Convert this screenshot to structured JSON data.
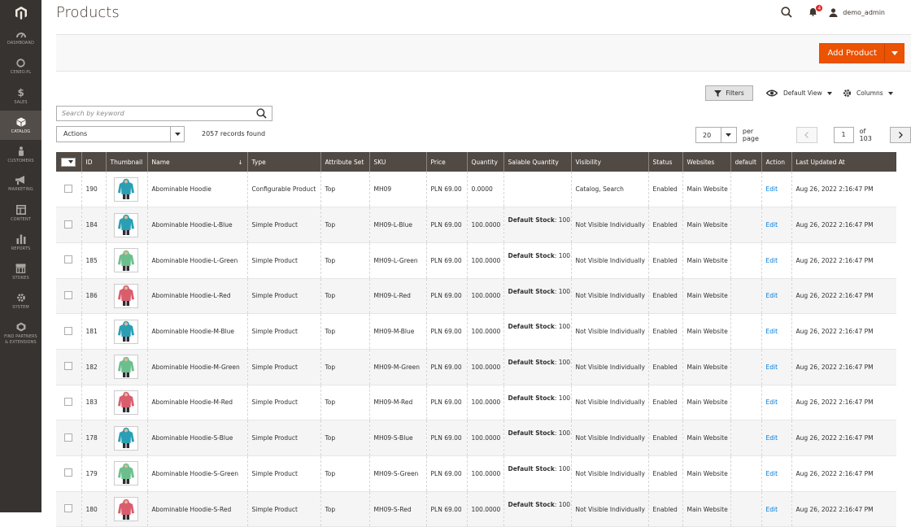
{
  "sidebar": {
    "items": [
      {
        "label": "DASHBOARD",
        "icon": "dashboard-icon"
      },
      {
        "label": "CENEO.PL",
        "icon": "ceneo-icon"
      },
      {
        "label": "SALES",
        "icon": "dollar-icon"
      },
      {
        "label": "CATALOG",
        "icon": "cube-icon",
        "active": true
      },
      {
        "label": "CUSTOMERS",
        "icon": "person-icon"
      },
      {
        "label": "MARKETING",
        "icon": "megaphone-icon"
      },
      {
        "label": "CONTENT",
        "icon": "layout-icon"
      },
      {
        "label": "REPORTS",
        "icon": "bar-chart-icon"
      },
      {
        "label": "STORES",
        "icon": "store-icon"
      },
      {
        "label": "SYSTEM",
        "icon": "gear-icon"
      },
      {
        "label": "FIND PARTNERS & EXTENSIONS",
        "icon": "partners-icon"
      }
    ]
  },
  "header": {
    "title": "Products",
    "notifications_count": "4",
    "user": "demo_admin"
  },
  "toolbar": {
    "add_product_label": "Add Product",
    "filters_label": "Filters",
    "view_label": "Default View",
    "columns_label": "Columns"
  },
  "search": {
    "placeholder": "Search by keyword"
  },
  "mass_actions": {
    "label": "Actions"
  },
  "records_found": "2057 records found",
  "pagination": {
    "per_page_value": "20",
    "per_page_label": "per page",
    "current_page": "1",
    "total_label": "of 103"
  },
  "grid": {
    "columns": [
      "ID",
      "Thumbnail",
      "Name",
      "Type",
      "Attribute Set",
      "SKU",
      "Price",
      "Quantity",
      "Salable Quantity",
      "Visibility",
      "Status",
      "Websites",
      "default",
      "Action",
      "Last Updated At"
    ],
    "rows": [
      {
        "id": "190",
        "name": "Abominable Hoodie",
        "type": "Configurable Product",
        "attribute_set": "Top",
        "sku": "MH09",
        "price": "PLN 69.00",
        "quantity": "0.0000",
        "salable_label": "",
        "salable_value": "",
        "visibility": "Catalog, Search",
        "status": "Enabled",
        "websites": "Main Website",
        "action": "Edit",
        "updated": "Aug 26, 2022 2:16:47 PM",
        "color": "blue"
      },
      {
        "id": "184",
        "name": "Abominable Hoodie-L-Blue",
        "type": "Simple Product",
        "attribute_set": "Top",
        "sku": "MH09-L-Blue",
        "price": "PLN 69.00",
        "quantity": "100.0000",
        "salable_label": "Default Stock",
        "salable_value": ": 100",
        "visibility": "Not Visible Individually",
        "status": "Enabled",
        "websites": "Main Website",
        "action": "Edit",
        "updated": "Aug 26, 2022 2:16:47 PM",
        "color": "blue"
      },
      {
        "id": "185",
        "name": "Abominable Hoodie-L-Green",
        "type": "Simple Product",
        "attribute_set": "Top",
        "sku": "MH09-L-Green",
        "price": "PLN 69.00",
        "quantity": "100.0000",
        "salable_label": "Default Stock",
        "salable_value": ": 100",
        "visibility": "Not Visible Individually",
        "status": "Enabled",
        "websites": "Main Website",
        "action": "Edit",
        "updated": "Aug 26, 2022 2:16:47 PM",
        "color": "green"
      },
      {
        "id": "186",
        "name": "Abominable Hoodie-L-Red",
        "type": "Simple Product",
        "attribute_set": "Top",
        "sku": "MH09-L-Red",
        "price": "PLN 69.00",
        "quantity": "100.0000",
        "salable_label": "Default Stock",
        "salable_value": ": 100",
        "visibility": "Not Visible Individually",
        "status": "Enabled",
        "websites": "Main Website",
        "action": "Edit",
        "updated": "Aug 26, 2022 2:16:47 PM",
        "color": "red"
      },
      {
        "id": "181",
        "name": "Abominable Hoodie-M-Blue",
        "type": "Simple Product",
        "attribute_set": "Top",
        "sku": "MH09-M-Blue",
        "price": "PLN 69.00",
        "quantity": "100.0000",
        "salable_label": "Default Stock",
        "salable_value": ": 100",
        "visibility": "Not Visible Individually",
        "status": "Enabled",
        "websites": "Main Website",
        "action": "Edit",
        "updated": "Aug 26, 2022 2:16:47 PM",
        "color": "blue"
      },
      {
        "id": "182",
        "name": "Abominable Hoodie-M-Green",
        "type": "Simple Product",
        "attribute_set": "Top",
        "sku": "MH09-M-Green",
        "price": "PLN 69.00",
        "quantity": "100.0000",
        "salable_label": "Default Stock",
        "salable_value": ": 100",
        "visibility": "Not Visible Individually",
        "status": "Enabled",
        "websites": "Main Website",
        "action": "Edit",
        "updated": "Aug 26, 2022 2:16:47 PM",
        "color": "green"
      },
      {
        "id": "183",
        "name": "Abominable Hoodie-M-Red",
        "type": "Simple Product",
        "attribute_set": "Top",
        "sku": "MH09-M-Red",
        "price": "PLN 69.00",
        "quantity": "100.0000",
        "salable_label": "Default Stock",
        "salable_value": ": 100",
        "visibility": "Not Visible Individually",
        "status": "Enabled",
        "websites": "Main Website",
        "action": "Edit",
        "updated": "Aug 26, 2022 2:16:47 PM",
        "color": "red"
      },
      {
        "id": "178",
        "name": "Abominable Hoodie-S-Blue",
        "type": "Simple Product",
        "attribute_set": "Top",
        "sku": "MH09-S-Blue",
        "price": "PLN 69.00",
        "quantity": "100.0000",
        "salable_label": "Default Stock",
        "salable_value": ": 100",
        "visibility": "Not Visible Individually",
        "status": "Enabled",
        "websites": "Main Website",
        "action": "Edit",
        "updated": "Aug 26, 2022 2:16:47 PM",
        "color": "blue"
      },
      {
        "id": "179",
        "name": "Abominable Hoodie-S-Green",
        "type": "Simple Product",
        "attribute_set": "Top",
        "sku": "MH09-S-Green",
        "price": "PLN 69.00",
        "quantity": "100.0000",
        "salable_label": "Default Stock",
        "salable_value": ": 100",
        "visibility": "Not Visible Individually",
        "status": "Enabled",
        "websites": "Main Website",
        "action": "Edit",
        "updated": "Aug 26, 2022 2:16:47 PM",
        "color": "green"
      },
      {
        "id": "180",
        "name": "Abominable Hoodie-S-Red",
        "type": "Simple Product",
        "attribute_set": "Top",
        "sku": "MH09-S-Red",
        "price": "PLN 69.00",
        "quantity": "100.0000",
        "salable_label": "Default Stock",
        "salable_value": ": 100",
        "visibility": "Not Visible Individually",
        "status": "Enabled",
        "websites": "Main Website",
        "action": "Edit",
        "updated": "Aug 26, 2022 2:16:47 PM",
        "color": "red"
      }
    ]
  },
  "colors": {
    "accent": "#eb5202",
    "sidebar_bg": "#373330",
    "header_bg": "#514943",
    "link": "#007bdb",
    "hoodie_blue": "#2a9fb4",
    "hoodie_green": "#6cbf8d",
    "hoodie_red": "#d95d6c"
  }
}
